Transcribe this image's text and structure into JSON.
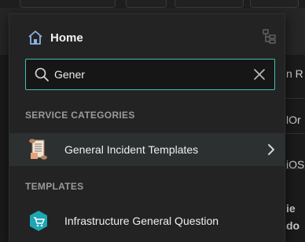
{
  "popup": {
    "home_title": "Home",
    "search": {
      "value": "Gener",
      "placeholder": ""
    },
    "sections": {
      "service_categories": "SERVICE CATEGORIES",
      "templates": "TEMPLATES"
    },
    "service_categories": [
      {
        "label": "General Incident Templates",
        "icon": "scroll-icon"
      }
    ],
    "templates": [
      {
        "label": "Infrastructure General Question",
        "icon": "cart-icon"
      }
    ]
  },
  "background": {
    "right_fragments": [
      "n R",
      "lOr",
      "iOS",
      "ie",
      "do"
    ]
  },
  "colors": {
    "accent": "#3fbfae",
    "popup_bg": "#232323",
    "active_row_bg": "#2c3030",
    "section_label": "#9a9a9a"
  }
}
